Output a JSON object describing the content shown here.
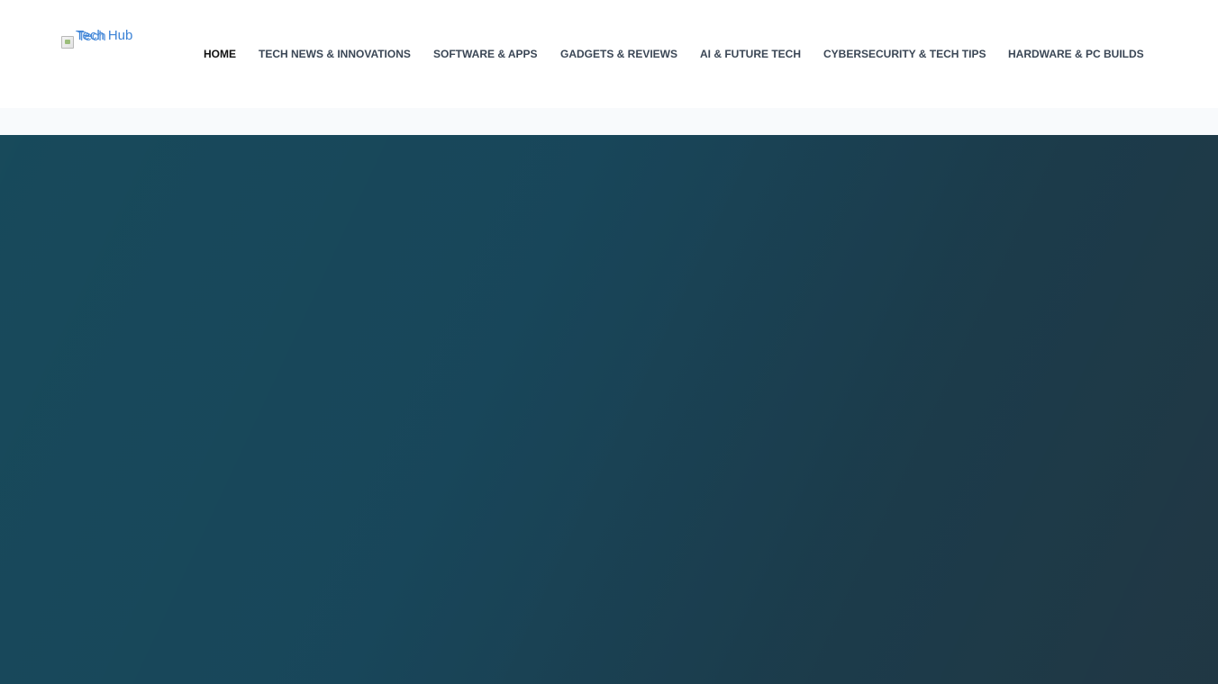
{
  "header": {
    "logo": {
      "alt_text": "Tech Hub",
      "alt_text_overlap": "Tech",
      "color": "#3b82d6"
    },
    "nav": {
      "items": [
        {
          "label": "HOME",
          "active": true
        },
        {
          "label": "TECH NEWS & INNOVATIONS",
          "active": false
        },
        {
          "label": "SOFTWARE & APPS",
          "active": false
        },
        {
          "label": "GADGETS & REVIEWS",
          "active": false
        },
        {
          "label": "AI & FUTURE TECH",
          "active": false
        },
        {
          "label": "CYBERSECURITY & TECH TIPS",
          "active": false
        },
        {
          "label": "HARDWARE & PC BUILDS",
          "active": false
        }
      ],
      "active_color": "#111111",
      "text_color": "#3a4655"
    }
  },
  "hero": {
    "gradient_start": "#134658",
    "gradient_end": "#223a47"
  },
  "colors": {
    "page_background": "#ffffff",
    "subbar_background": "#f8fafc"
  }
}
